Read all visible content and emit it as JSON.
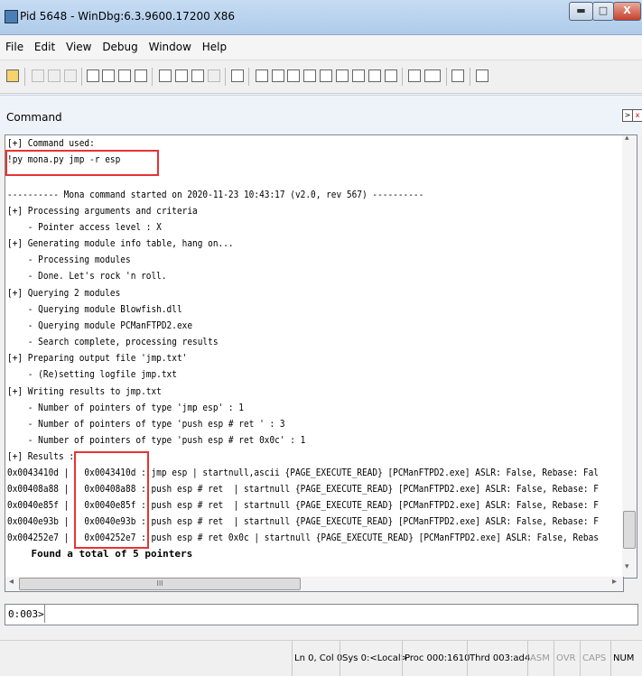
{
  "window": {
    "title": "Pid 5648 - WinDbg:6.3.9600.17200 X86",
    "min_glyph": "▬",
    "max_glyph": "□",
    "close_glyph": "X"
  },
  "menu": [
    "File",
    "Edit",
    "View",
    "Debug",
    "Window",
    "Help"
  ],
  "command_window": {
    "label": "Command",
    "output_lines": [
      "[+] Command used:",
      "!py mona.py jmp -r esp",
      "",
      "---------- Mona command started on 2020-11-23 10:43:17 (v2.0, rev 567) ----------",
      "[+] Processing arguments and criteria",
      "    - Pointer access level : X",
      "[+] Generating module info table, hang on...",
      "    - Processing modules",
      "    - Done. Let's rock 'n roll.",
      "[+] Querying 2 modules",
      "    - Querying module Blowfish.dll",
      "    - Querying module PCManFTPD2.exe",
      "    - Search complete, processing results",
      "[+] Preparing output file 'jmp.txt'",
      "    - (Re)setting logfile jmp.txt",
      "[+] Writing results to jmp.txt",
      "    - Number of pointers of type 'jmp esp' : 1",
      "    - Number of pointers of type 'push esp # ret ' : 3",
      "    - Number of pointers of type 'push esp # ret 0x0c' : 1",
      "[+] Results :",
      "0x0043410d |   0x0043410d : jmp esp | startnull,ascii {PAGE_EXECUTE_READ} [PCManFTPD2.exe] ASLR: False, Rebase: Fal",
      "0x00408a88 |   0x00408a88 : push esp # ret  | startnull {PAGE_EXECUTE_READ} [PCManFTPD2.exe] ASLR: False, Rebase: F",
      "0x0040e85f |   0x0040e85f : push esp # ret  | startnull {PAGE_EXECUTE_READ} [PCManFTPD2.exe] ASLR: False, Rebase: F",
      "0x0040e93b |   0x0040e93b : push esp # ret  | startnull {PAGE_EXECUTE_READ} [PCManFTPD2.exe] ASLR: False, Rebase: F",
      "0x004252e7 |   0x004252e7 : push esp # ret 0x0c | startnull {PAGE_EXECUTE_READ} [PCManFTPD2.exe] ASLR: False, Rebas",
      "    Found a total of 5 pointers"
    ],
    "prompt": "0:003>",
    "input_value": "",
    "scroll_left_glyph": "◂",
    "scroll_right_glyph": "▸",
    "scroll_up_glyph": "▴",
    "scroll_down_glyph": "▾",
    "h_thumb_glyph": "III"
  },
  "status": {
    "position": "Ln 0, Col 0",
    "sys": "Sys 0:<Local>",
    "proc": "Proc 000:1610",
    "thrd": "Thrd 003:ad4",
    "asm": "ASM",
    "ovr": "OVR",
    "caps": "CAPS",
    "num": "NUM"
  },
  "colors": {
    "highlight_box": "#e63333",
    "titlebar": "#b9d3ee"
  }
}
